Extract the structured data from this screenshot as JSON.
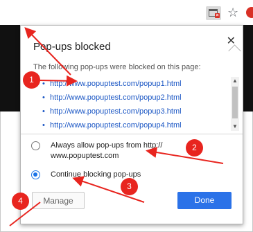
{
  "popup": {
    "title": "Pop-ups blocked",
    "close_label": "✕",
    "description": "The following pop-ups were blocked on this page:",
    "blocked_urls": [
      "http://www.popuptest.com/popup1.html",
      "http://www.popuptest.com/popup2.html",
      "http://www.popuptest.com/popup3.html",
      "http://www.popuptest.com/popup4.html"
    ],
    "option_allow": "Always allow pop-ups from http:// www.popuptest.com",
    "option_block": "Continue blocking pop-ups",
    "selected_option": "block",
    "manage_label": "Manage",
    "done_label": "Done"
  },
  "toolbar": {
    "icons": [
      "popup-blocked-icon",
      "star-icon",
      "profile-icon"
    ]
  },
  "annotations": {
    "badges": [
      "1",
      "2",
      "3",
      "4"
    ],
    "color": "#e8251f"
  },
  "colors": {
    "accent": "#2b72e8",
    "link": "#1a56c4",
    "annotation": "#e8251f"
  }
}
